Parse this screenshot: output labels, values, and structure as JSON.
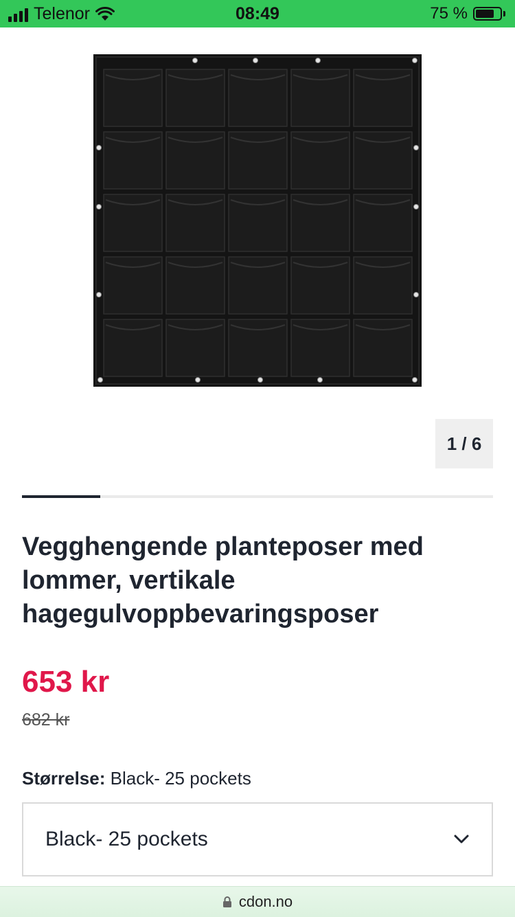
{
  "status_bar": {
    "carrier": "Telenor",
    "time": "08:49",
    "battery": "75 %",
    "battery_level": 0.75
  },
  "gallery": {
    "counter": "1 / 6",
    "current": 1,
    "total": 6
  },
  "product": {
    "title": "Vegghengende planteposer med lommer, vertikale hagegulvoppbevaringsposer",
    "price": "653 kr",
    "old_price": "682 kr"
  },
  "size": {
    "label": "Størrelse:",
    "value": "Black- 25 pockets",
    "selected": "Black- 25 pockets"
  },
  "browser": {
    "url": "cdon.no"
  },
  "colors": {
    "status_bar": "#33c759",
    "price": "#e0174a",
    "text": "#1f2530"
  }
}
